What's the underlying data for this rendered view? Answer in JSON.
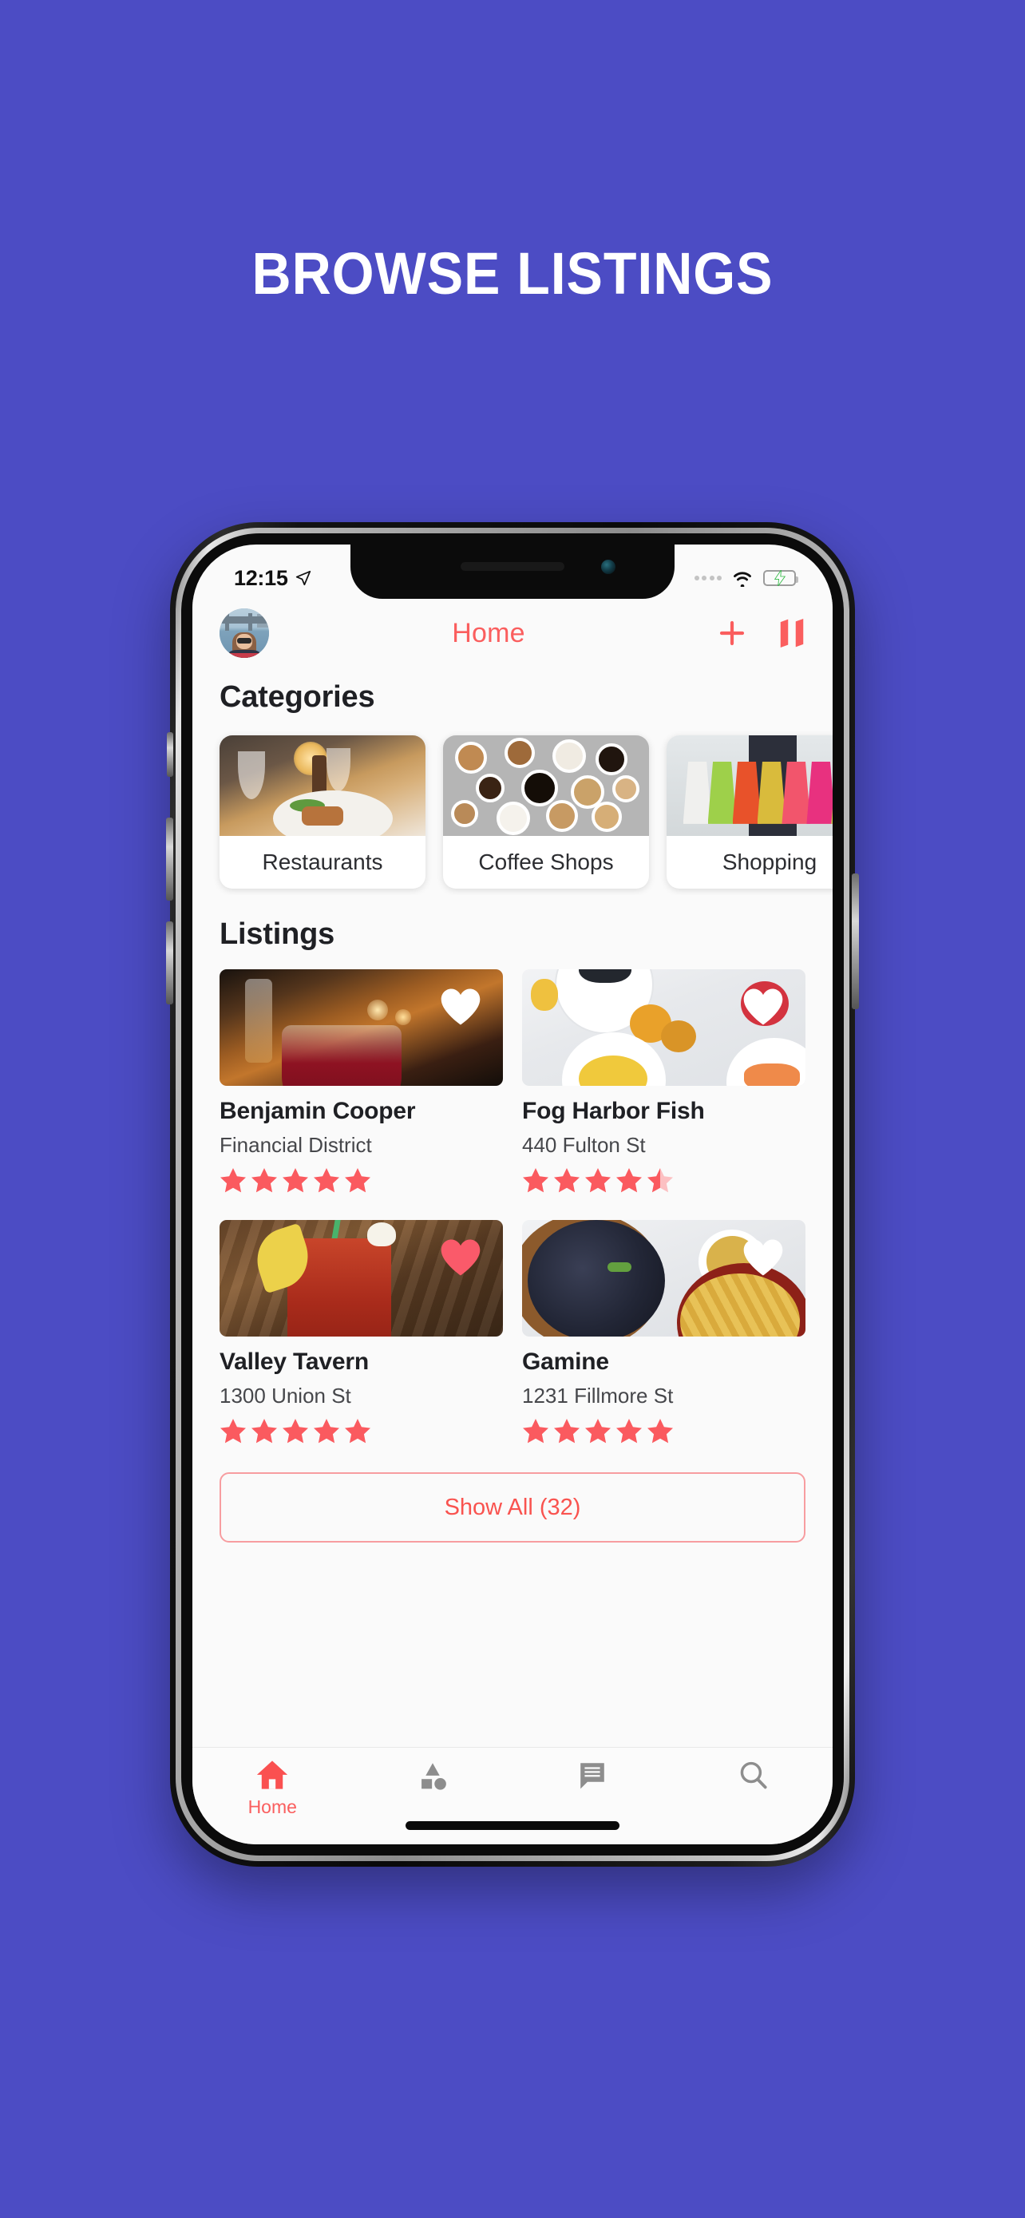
{
  "hero": {
    "title": "BROWSE LISTINGS"
  },
  "theme": {
    "background": "#4c4cc4",
    "accent": "#fa5e5e",
    "accent_button": "#f9534f",
    "star": "#fa5a5f",
    "text_dark": "#1f2024",
    "screen_bg": "#fafafa"
  },
  "status_bar": {
    "time": "12:15",
    "location_icon": "location-arrow-icon",
    "dots_icon": "signal-dots-icon",
    "wifi_icon": "wifi-icon",
    "battery_icon": "battery-charging-icon",
    "battery_charging": true
  },
  "navbar": {
    "avatar": "user-avatar",
    "title": "Home",
    "add_icon": "plus-icon",
    "map_icon": "map-icon"
  },
  "categories": {
    "heading": "Categories",
    "items": [
      {
        "label": "Restaurants",
        "image": "restaurant-table-photo"
      },
      {
        "label": "Coffee Shops",
        "image": "coffee-cups-photo"
      },
      {
        "label": "Shopping",
        "image": "shopping-bags-photo"
      }
    ]
  },
  "listings": {
    "heading": "Listings",
    "items": [
      {
        "name": "Benjamin Cooper",
        "address": "Financial District",
        "rating": 5,
        "favorited": false,
        "image": "cocktail-bar-photo"
      },
      {
        "name": "Fog Harbor Fish",
        "address": "440 Fulton St",
        "rating": 4.5,
        "favorited": false,
        "image": "brunch-table-photo"
      },
      {
        "name": "Valley Tavern",
        "address": "1300 Union St",
        "rating": 5,
        "favorited": true,
        "image": "bloody-mary-photo"
      },
      {
        "name": "Gamine",
        "address": "1231 Fillmore St",
        "rating": 5,
        "favorited": false,
        "image": "mussels-frites-photo"
      }
    ],
    "show_all_label": "Show All (32)"
  },
  "tabbar": {
    "items": [
      {
        "label": "Home",
        "icon": "home-icon",
        "active": true
      },
      {
        "label": "",
        "icon": "shapes-icon",
        "active": false
      },
      {
        "label": "",
        "icon": "chat-icon",
        "active": false
      },
      {
        "label": "",
        "icon": "search-icon",
        "active": false
      }
    ]
  }
}
